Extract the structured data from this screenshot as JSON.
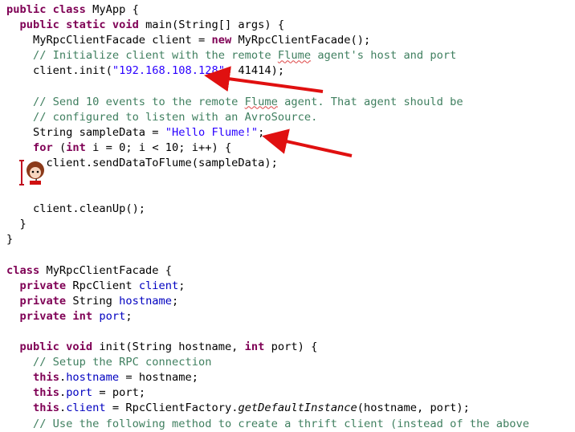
{
  "code_lines": [
    [
      [
        "kw",
        "public class "
      ],
      [
        "",
        "MyApp {"
      ]
    ],
    [
      [
        "",
        "  "
      ],
      [
        "kw",
        "public static void "
      ],
      [
        "",
        "main(String[] args) {"
      ]
    ],
    [
      [
        "",
        "    MyRpcClientFacade client = "
      ],
      [
        "kw",
        "new "
      ],
      [
        "",
        "MyRpcClientFacade();"
      ]
    ],
    [
      [
        "cm",
        "    // Initialize client with the remote "
      ],
      [
        "cm sq",
        "Flume"
      ],
      [
        "cm",
        " agent's host and port"
      ]
    ],
    [
      [
        "",
        "    client.init("
      ],
      [
        "st",
        "\"192.168.108.128\""
      ],
      [
        "",
        ", 41414);"
      ]
    ],
    [
      [
        "",
        ""
      ]
    ],
    [
      [
        "cm",
        "    // Send 10 events to the remote "
      ],
      [
        "cm sq",
        "Flume"
      ],
      [
        "cm",
        " agent. That agent should be"
      ]
    ],
    [
      [
        "cm",
        "    // configured to listen with an AvroSource."
      ]
    ],
    [
      [
        "",
        "    String sampleData = "
      ],
      [
        "st",
        "\"Hello Flume!\""
      ],
      [
        "",
        ";"
      ]
    ],
    [
      [
        "",
        "    "
      ],
      [
        "kw",
        "for "
      ],
      [
        "",
        "("
      ],
      [
        "kw",
        "int "
      ],
      [
        "",
        "i = 0; i < 10; i++) {"
      ]
    ],
    [
      [
        "",
        "      client.sendDataToFlume(sampleData);"
      ]
    ],
    [
      [
        "",
        "    }"
      ]
    ],
    [
      [
        "",
        ""
      ]
    ],
    [
      [
        "",
        "    client.cleanUp();"
      ]
    ],
    [
      [
        "",
        "  }"
      ]
    ],
    [
      [
        "",
        "}"
      ]
    ],
    [
      [
        "",
        ""
      ]
    ],
    [
      [
        "kw",
        "class "
      ],
      [
        "",
        "MyRpcClientFacade {"
      ]
    ],
    [
      [
        "",
        "  "
      ],
      [
        "kw",
        "private "
      ],
      [
        "",
        "RpcClient "
      ],
      [
        "fd",
        "client"
      ],
      [
        "",
        ";"
      ]
    ],
    [
      [
        "",
        "  "
      ],
      [
        "kw",
        "private "
      ],
      [
        "",
        "String "
      ],
      [
        "fd",
        "hostname"
      ],
      [
        "",
        ";"
      ]
    ],
    [
      [
        "",
        "  "
      ],
      [
        "kw",
        "private int "
      ],
      [
        "fd",
        "port"
      ],
      [
        "",
        ";"
      ]
    ],
    [
      [
        "",
        ""
      ]
    ],
    [
      [
        "",
        "  "
      ],
      [
        "kw",
        "public void "
      ],
      [
        "",
        "init(String hostname, "
      ],
      [
        "kw",
        "int "
      ],
      [
        "",
        "port) {"
      ]
    ],
    [
      [
        "cm",
        "    // Setup the RPC connection"
      ]
    ],
    [
      [
        "",
        "    "
      ],
      [
        "kw",
        "this"
      ],
      [
        "",
        "."
      ],
      [
        "fd",
        "hostname"
      ],
      [
        "",
        " = hostname;"
      ]
    ],
    [
      [
        "",
        "    "
      ],
      [
        "kw",
        "this"
      ],
      [
        "",
        "."
      ],
      [
        "fd",
        "port"
      ],
      [
        "",
        " = port;"
      ]
    ],
    [
      [
        "",
        "    "
      ],
      [
        "kw",
        "this"
      ],
      [
        "",
        "."
      ],
      [
        "fd",
        "client"
      ],
      [
        "",
        " = RpcClientFactory."
      ],
      [
        "it",
        "getDefaultInstance"
      ],
      [
        "",
        "(hostname, port);"
      ]
    ],
    [
      [
        "cm",
        "    // Use the following method to create a thrift client (instead of the above"
      ]
    ]
  ],
  "colors": {
    "keyword": "#7f0055",
    "comment": "#3f7f5f",
    "string": "#2a00ff",
    "field": "#0000c0",
    "arrow": "#e01010"
  },
  "icons": {
    "cursor": "text-cursor-mascot-icon",
    "arrows": "red-arrow-icon"
  }
}
